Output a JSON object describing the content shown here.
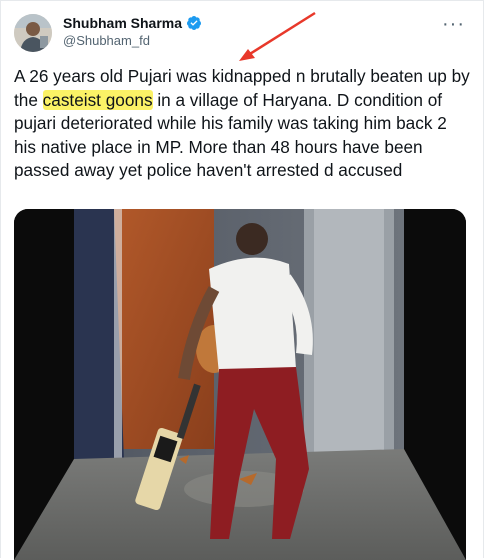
{
  "author": {
    "name": "Shubham Sharma",
    "handle": "@Shubham_fd",
    "verified": true,
    "verified_color": "#1d9bf0"
  },
  "tweet": {
    "text_before": "A 26 years old Pujari was kidnapped n brutally beaten up by the ",
    "highlighted": "casteist goons",
    "text_after": " in a village of Haryana. D condition of pujari deteriorated while his family was taking him back 2 his native place in MP. More than 48 hours have been passed away yet police haven't arrested d accused",
    "highlight_color": "#fbf266"
  },
  "menu": {
    "icon": "more-horizontal-icon",
    "label": "···"
  },
  "annotation": {
    "icon": "red-arrow-icon",
    "color": "#e8382a"
  },
  "media": {
    "type": "video-still"
  }
}
